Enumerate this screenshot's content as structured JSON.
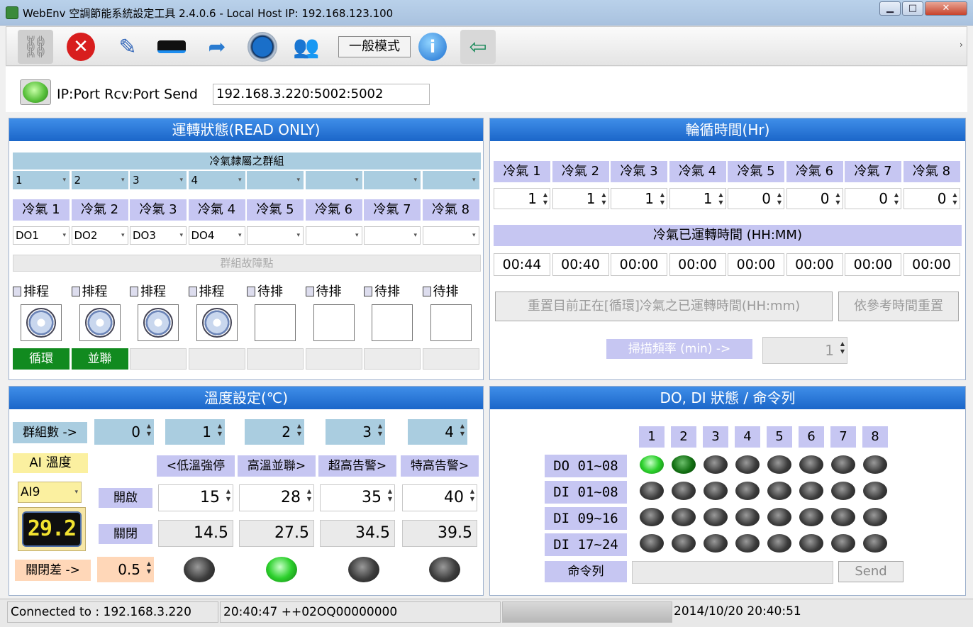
{
  "title": "WebEnv 空調節能系統設定工具  2.4.0.6  - Local Host IP: 192.168.123.100",
  "window_buttons": {
    "minimize": "▁",
    "maximize": "□",
    "close": "✕"
  },
  "toolbar": {
    "mode_label": "一般模式",
    "icons": [
      "connect-icon",
      "stop-icon",
      "edit-icon",
      "router-icon",
      "export-icon",
      "gauge-icon",
      "user-icon",
      "info-icon",
      "exit-icon"
    ]
  },
  "connection": {
    "label": "IP:Port Rcv:Port Send",
    "value": "192.168.3.220:5002:5002"
  },
  "run_panel": {
    "title": "運轉狀態(READ ONLY)",
    "group_header": "冷氣隸屬之群組",
    "groups": [
      "1",
      "2",
      "3",
      "4",
      "",
      "",
      "",
      ""
    ],
    "ac_labels": [
      "冷氣 1",
      "冷氣 2",
      "冷氣 3",
      "冷氣 4",
      "冷氣 5",
      "冷氣 6",
      "冷氣 7",
      "冷氣 8"
    ],
    "do_values": [
      "DO1",
      "DO2",
      "DO3",
      "DO4",
      "",
      "",
      "",
      ""
    ],
    "fault_label": "群組故障點",
    "schedule": [
      "排程",
      "排程",
      "排程",
      "排程",
      "待排",
      "待排",
      "待排",
      "待排"
    ],
    "fans": [
      true,
      true,
      true,
      true,
      false,
      false,
      false,
      false
    ],
    "states": [
      "循環",
      "並聯",
      "",
      "",
      "",
      "",
      "",
      ""
    ]
  },
  "cycle_panel": {
    "title": "輪循時間(Hr)",
    "ac_labels": [
      "冷氣 1",
      "冷氣 2",
      "冷氣 3",
      "冷氣 4",
      "冷氣 5",
      "冷氣 6",
      "冷氣 7",
      "冷氣 8"
    ],
    "hours": [
      "1",
      "1",
      "1",
      "1",
      "0",
      "0",
      "0",
      "0"
    ],
    "runtime_header": "冷氣已運轉時間 (HH:MM)",
    "runtimes": [
      "00:44",
      "00:40",
      "00:00",
      "00:00",
      "00:00",
      "00:00",
      "00:00",
      "00:00"
    ],
    "reset_current": "重置目前正在[循環]冷氣之已運轉時間(HH:mm)",
    "reset_ref": "依參考時間重置",
    "scan_label": "掃描頻率 (min) ->",
    "scan_value": "1"
  },
  "temp_panel": {
    "title": "溫度設定(℃)",
    "group_count_label": "群組數 ->",
    "group_values": [
      "0",
      "1",
      "2",
      "3",
      "4"
    ],
    "ai_label": "AI 溫度",
    "ai_select": "AI9",
    "display": "29.2",
    "col_headers": [
      "<低溫強停",
      "高溫並聯>",
      "超高告警>",
      "特高告警>"
    ],
    "open_label": "開啟",
    "open_values": [
      "15",
      "28",
      "35",
      "40"
    ],
    "close_label": "關閉",
    "close_values": [
      "14.5",
      "27.5",
      "34.5",
      "39.5"
    ],
    "diff_label": "關閉差 ->",
    "diff_value": "0.5",
    "indicators": [
      "off",
      "on",
      "off",
      "off"
    ]
  },
  "dodi_panel": {
    "title": "DO, DI 狀態 / 命令列",
    "columns": [
      "1",
      "2",
      "3",
      "4",
      "5",
      "6",
      "7",
      "8"
    ],
    "rows": [
      {
        "label": "DO 01~08",
        "states": [
          "on",
          "dkg",
          "off",
          "off",
          "off",
          "off",
          "off",
          "off"
        ]
      },
      {
        "label": "DI 01~08",
        "states": [
          "off",
          "off",
          "off",
          "off",
          "off",
          "off",
          "off",
          "off"
        ]
      },
      {
        "label": "DI 09~16",
        "states": [
          "off",
          "off",
          "off",
          "off",
          "off",
          "off",
          "off",
          "off"
        ]
      },
      {
        "label": "DI 17~24",
        "states": [
          "off",
          "off",
          "off",
          "off",
          "off",
          "off",
          "off",
          "off"
        ]
      }
    ],
    "cmd_label": "命令列",
    "cmd_value": "",
    "send_label": "Send"
  },
  "statusbar": {
    "connected": "Connected to : 192.168.3.220",
    "last_msg": "20:40:47 ++02OQ00000000",
    "datetime": "2014/10/20 20:40:51"
  }
}
